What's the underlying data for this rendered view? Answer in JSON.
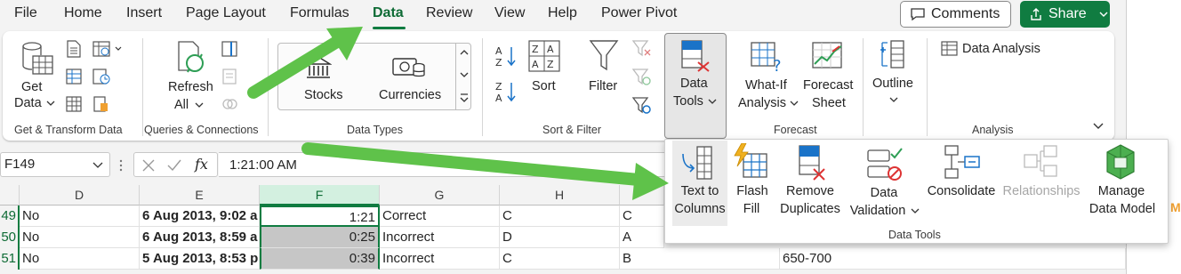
{
  "menu": {
    "tabs": [
      "File",
      "Home",
      "Insert",
      "Page Layout",
      "Formulas",
      "Data",
      "Review",
      "View",
      "Help",
      "Power Pivot"
    ],
    "active": "Data",
    "comments_label": "Comments",
    "share_label": "Share"
  },
  "ribbon": {
    "get_data_label_1": "Get",
    "get_data_label_2": "Data",
    "refresh_all_label_1": "Refresh",
    "refresh_all_label_2": "All",
    "stocks_label": "Stocks",
    "currencies_label": "Currencies",
    "sort_label": "Sort",
    "filter_label": "Filter",
    "data_tools_label_1": "Data",
    "data_tools_label_2": "Tools",
    "what_if_label_1": "What-If",
    "what_if_label_2": "Analysis",
    "forecast_sheet_label_1": "Forecast",
    "forecast_sheet_label_2": "Sheet",
    "outline_label": "Outline",
    "data_analysis_label": "Data Analysis",
    "groups": {
      "get_transform": "Get & Transform Data",
      "queries": "Queries & Connections",
      "data_types": "Data Types",
      "sort_filter": "Sort & Filter",
      "forecast": "Forecast",
      "analysis": "Analysis"
    }
  },
  "formula_bar": {
    "name_box": "F149",
    "fx": "fx",
    "formula": "1:21:00 AM"
  },
  "grid": {
    "columns": [
      "D",
      "E",
      "F",
      "G",
      "H"
    ],
    "selected_column": "F",
    "rows": [
      {
        "row": "49",
        "D": "No",
        "E": "6 Aug 2013, 9:02 a",
        "F": "1:21",
        "G": "Correct",
        "H": "C",
        "I": "C",
        "J": ""
      },
      {
        "row": "50",
        "D": "No",
        "E": "6 Aug 2013, 8:59 a",
        "F": "0:25",
        "G": "Incorrect",
        "H": "D",
        "I": "A",
        "J": ""
      },
      {
        "row": "51",
        "D": "No",
        "E": "5 Aug 2013, 8:53 p",
        "F": "0:39",
        "G": "Incorrect",
        "H": "C",
        "I": "B",
        "J": "650-700"
      }
    ]
  },
  "data_tools_dropdown": {
    "items": [
      {
        "line1": "Text to",
        "line2": "Columns"
      },
      {
        "line1": "Flash",
        "line2": "Fill"
      },
      {
        "line1": "Remove",
        "line2": "Duplicates"
      },
      {
        "line1": "Data",
        "line2": "Validation"
      },
      {
        "line1": "Consolidate",
        "line2": ""
      },
      {
        "line1": "Relationships",
        "line2": ""
      },
      {
        "line1": "Manage",
        "line2": "Data Model"
      }
    ],
    "group_label": "Data Tools",
    "edge_text": "MA"
  },
  "colors": {
    "accent_green": "#107c41",
    "arrow_green": "#5fc24a"
  }
}
